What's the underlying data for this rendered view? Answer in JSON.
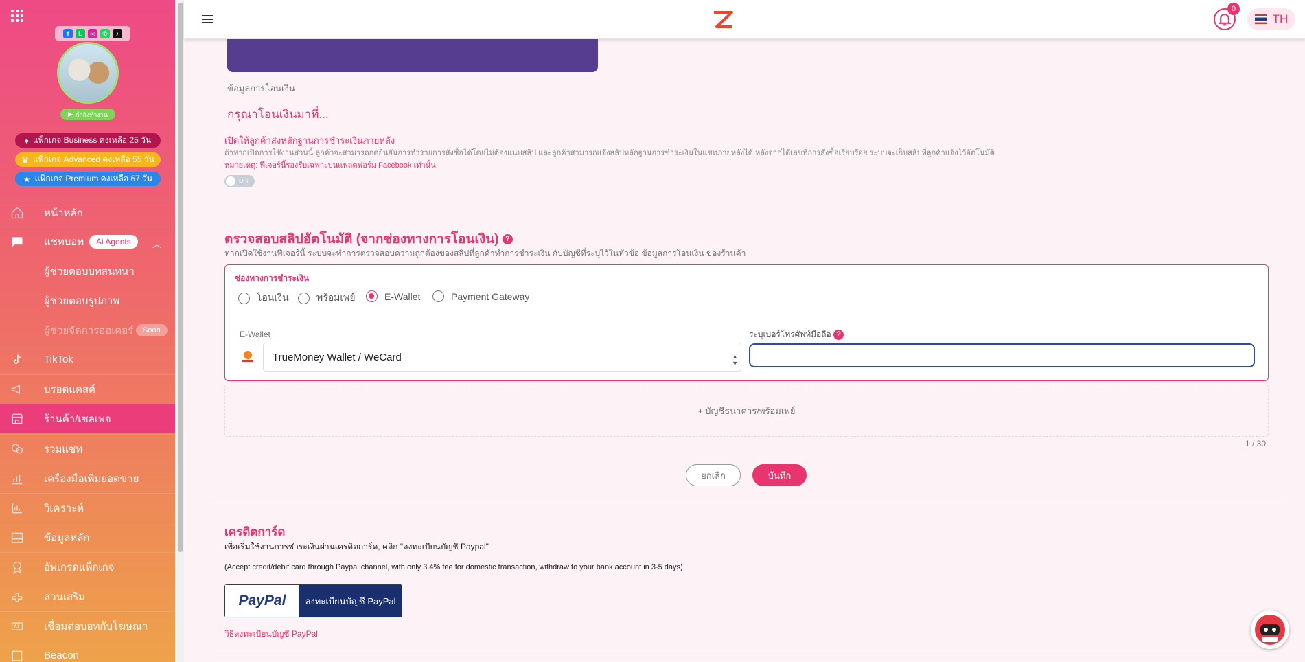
{
  "sidebar": {
    "status_label": "กำลังทำงาน",
    "packages": [
      {
        "label": "แพ็กเกจ Business คงเหลือ 25 วัน"
      },
      {
        "label": "แพ็กเกจ Advanced คงเหลือ 55 วัน"
      },
      {
        "label": "แพ็กเกจ Premium คงเหลือ 67 วัน"
      }
    ],
    "nav": [
      {
        "label": "หน้าหลัก",
        "icon": "home-icon"
      },
      {
        "label": "แชทบอท",
        "icon": "chat-icon",
        "badge": "Ai Agents"
      },
      {
        "label": "ผู้ช่วยตอบบทสนทนา"
      },
      {
        "label": "ผู้ช่วยตอบรูปภาพ"
      },
      {
        "label": "ผู้ช่วยจัดการออเดอร์",
        "badge": "Soon"
      },
      {
        "label": "TikTok",
        "icon": "tiktok-icon"
      },
      {
        "label": "บรอดแคสต์",
        "icon": "megaphone-icon"
      },
      {
        "label": "ร้านค้า/เซลเพจ",
        "icon": "store-icon",
        "active": true
      },
      {
        "label": "รวมแชท",
        "icon": "chats-icon"
      },
      {
        "label": "เครื่องมือเพิ่มยอดขาย",
        "icon": "chart-icon"
      },
      {
        "label": "วิเคราะห์",
        "icon": "analytics-icon"
      },
      {
        "label": "ข้อมูลหลัก",
        "icon": "database-icon"
      },
      {
        "label": "อัพเกรดแพ็กเกจ",
        "icon": "award-icon"
      },
      {
        "label": "ส่วนเสริม",
        "icon": "addon-icon"
      },
      {
        "label": "เชื่อมต่อบอทกับโฆษณา",
        "icon": "ads-icon"
      },
      {
        "label": "Beacon",
        "icon": "beacon-icon"
      }
    ]
  },
  "header": {
    "notification_count": "0",
    "language": "TH"
  },
  "transfer": {
    "section_label": "ข้อมูลการโอนเงิน",
    "prompt": "กรุณาโอนเงินมาที่...",
    "later_title": "เปิดให้ลูกค้าส่งหลักฐานการชำระเงินภายหลัง",
    "later_desc": "ถ้าหากเปิดการใช้งานส่วนนี้ ลูกค้าจะสามารถกดยืนยันการทำรายการสั่งซื้อได้โดยไม่ต้องแนบสลิป และลูกค้าสามารถแจ้งสลิปหลักฐานการชำระเงินในแชทภายหลังได้ หลังจากได้เลขที่การสั่งซื้อเรียบร้อย ระบบจะเก็บสลิปที่ลูกค้าแจ้งไว้อัตโนมัติ",
    "later_note": "หมายเหตุ: ฟีเจอร์นี้รองรับเฉพาะบนแพลตฟอร์ม Facebook เท่านั้น",
    "toggle_label": "OFF"
  },
  "slip": {
    "title": "ตรวจสอบสลิปอัตโนมัติ (จากช่องทางการโอนเงิน)",
    "desc": "หากเปิดใช้งานฟีเจอร์นี้ ระบบจะทำการตรวจสอบความถูกต้องของสลิปที่ลูกค้าทำการชำระเงิน กับบัญชีที่ระบุไว้ในหัวข้อ ข้อมูลการโอนเงิน ของร้านค้า",
    "channel_label": "ช่องทางการชำระเงิน",
    "options": [
      "โอนเงิน",
      "พร้อมเพย์",
      "E-Wallet",
      "Payment Gateway"
    ],
    "selected": "E-Wallet",
    "ewallet_label": "E-Wallet",
    "ewallet_value": "TrueMoney Wallet / WeCard",
    "phone_label": "ระบุเบอร์โทรศัพท์มือถือ",
    "phone_value": "",
    "add_bank": "บัญชีธนาคาร/พร้อมเพย์",
    "counter": "1 / 30",
    "cancel": "ยกเลิก",
    "save": "บันทึก"
  },
  "credit": {
    "title": "เครดิตการ์ด",
    "intro": "เพื่อเริ่มใช้งานการชำระเงินผ่านเครดิตการ์ด, คลิก \"ลงทะเบียนบัญชี Paypal\"",
    "detail": "(Accept credit/debit card through Paypal channel, with only 3.4% fee for domestic transaction, withdraw to your bank account in 3-5 days)",
    "paypal_logo": "PayPal",
    "paypal_button": "ลงทะเบียนบัญชี PayPal",
    "howto_link": "วิธีลงทะเบียนบัญชี PayPal"
  },
  "colors": {
    "accent": "#e8356f",
    "paypal_dark": "#1a2f6d",
    "banner": "#563d8f"
  }
}
